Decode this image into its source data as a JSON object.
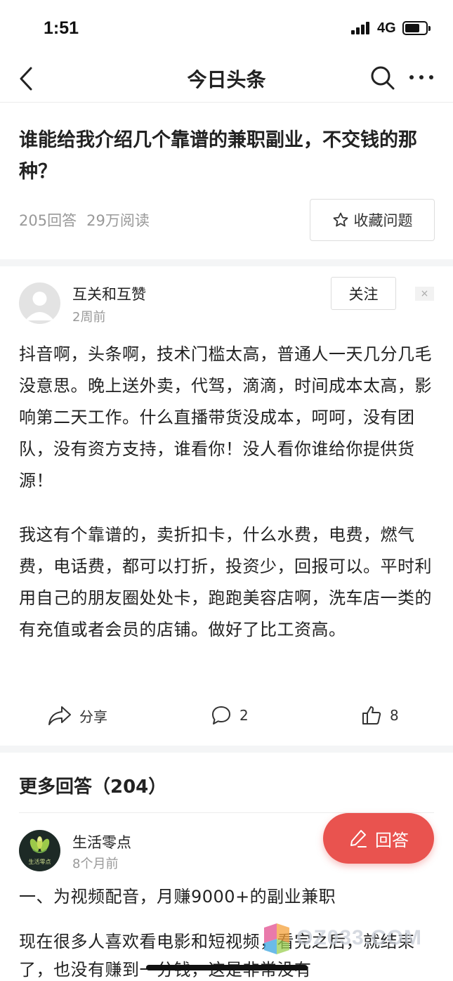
{
  "status_bar": {
    "time": "1:51",
    "network": "4G"
  },
  "nav": {
    "title": "今日头条",
    "icons": [
      "back-chevron-icon",
      "search-icon",
      "more-dots-icon"
    ]
  },
  "question": {
    "title": "谁能给我介绍几个靠谱的兼职副业，不交钱的那种？",
    "answer_count": "205回答",
    "read_count": "29万阅读",
    "favorite_label": "收藏问题"
  },
  "answer": {
    "author": "互关和互赞",
    "time": "2周前",
    "follow_label": "关注",
    "dismiss_symbol": "×",
    "paragraphs": [
      "抖音啊，头条啊，技术门槛太高，普通人一天几分几毛没意思。晚上送外卖，代驾，滴滴，时间成本太高，影响第二天工作。什么直播带货没成本，呵呵，没有团队，没有资方支持，谁看你！没人看你谁给你提供货源！",
      "我这有个靠谱的，卖折扣卡，什么水费，电费，燃气费，电话费，都可以打折，投资少，回报可以。平时利用自己的朋友圈处处卡，跑跑美容店啊，洗车店一类的有充值或者会员的店铺。做好了比工资高。"
    ],
    "share_label": "分享",
    "comment_count": "2",
    "like_count": "8"
  },
  "more_answers": {
    "title": "更多回答（204）",
    "author": "生活零点",
    "avatar_caption": "生活零点",
    "time": "8个月前",
    "headline": "一、为视频配音，月赚9000+的副业兼职",
    "text": "现在很多人喜欢看电影和短视频，看完之后，就结束了，也没有赚到一分钱，这是非常没有"
  },
  "fab": {
    "label": "回答"
  },
  "watermark": {
    "text": "OZ033.COM"
  },
  "colors": {
    "accent": "#e9534f",
    "muted_text": "#999999",
    "divider": "#f4f5f6"
  }
}
